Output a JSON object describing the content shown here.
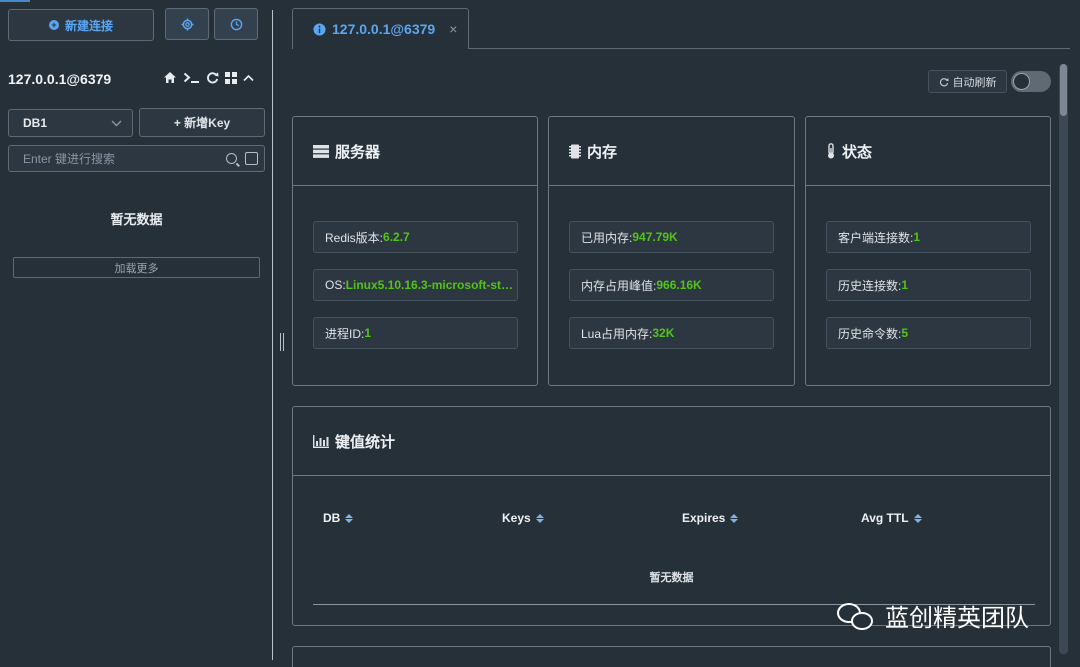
{
  "sidebar": {
    "new_connection_label": "新建连接",
    "settings_icon": "gear-icon",
    "history_icon": "clock-icon",
    "connection_name": "127.0.0.1@6379",
    "tools": [
      "home-icon",
      "terminal-icon",
      "refresh-icon",
      "grid-icon",
      "chevron-up-icon"
    ],
    "db_selected": "DB1",
    "add_key_label": "+ 新增Key",
    "search_placeholder": "Enter 键进行搜索",
    "empty_text": "暂无数据",
    "load_more_label": "加载更多"
  },
  "tab": {
    "label": "127.0.0.1@6379",
    "close": "×"
  },
  "toolbar": {
    "auto_refresh_label": "自动刷新",
    "auto_refresh_on": false
  },
  "cards": {
    "server": {
      "title": "服务器",
      "items": [
        {
          "label": "Redis版本:",
          "value": "6.2.7"
        },
        {
          "label": "OS:",
          "value": "Linux5.10.16.3-microsoft-st…"
        },
        {
          "label": "进程ID:",
          "value": "1"
        }
      ]
    },
    "memory": {
      "title": "内存",
      "items": [
        {
          "label": "已用内存:",
          "value": "947.79K"
        },
        {
          "label": "内存占用峰值:",
          "value": "966.16K"
        },
        {
          "label": "Lua占用内存:",
          "value": "32K"
        }
      ]
    },
    "status": {
      "title": "状态",
      "items": [
        {
          "label": "客户端连接数:",
          "value": "1"
        },
        {
          "label": "历史连接数:",
          "value": "1"
        },
        {
          "label": "历史命令数:",
          "value": "5"
        }
      ]
    }
  },
  "key_stats": {
    "title": "键值统计",
    "columns": [
      "DB",
      "Keys",
      "Expires",
      "Avg TTL"
    ],
    "empty_text": "暂无数据"
  },
  "watermark": {
    "text": "蓝创精英团队"
  },
  "colors": {
    "accent": "#5ba6f0",
    "value_green": "#52c41a",
    "background": "#263039"
  }
}
